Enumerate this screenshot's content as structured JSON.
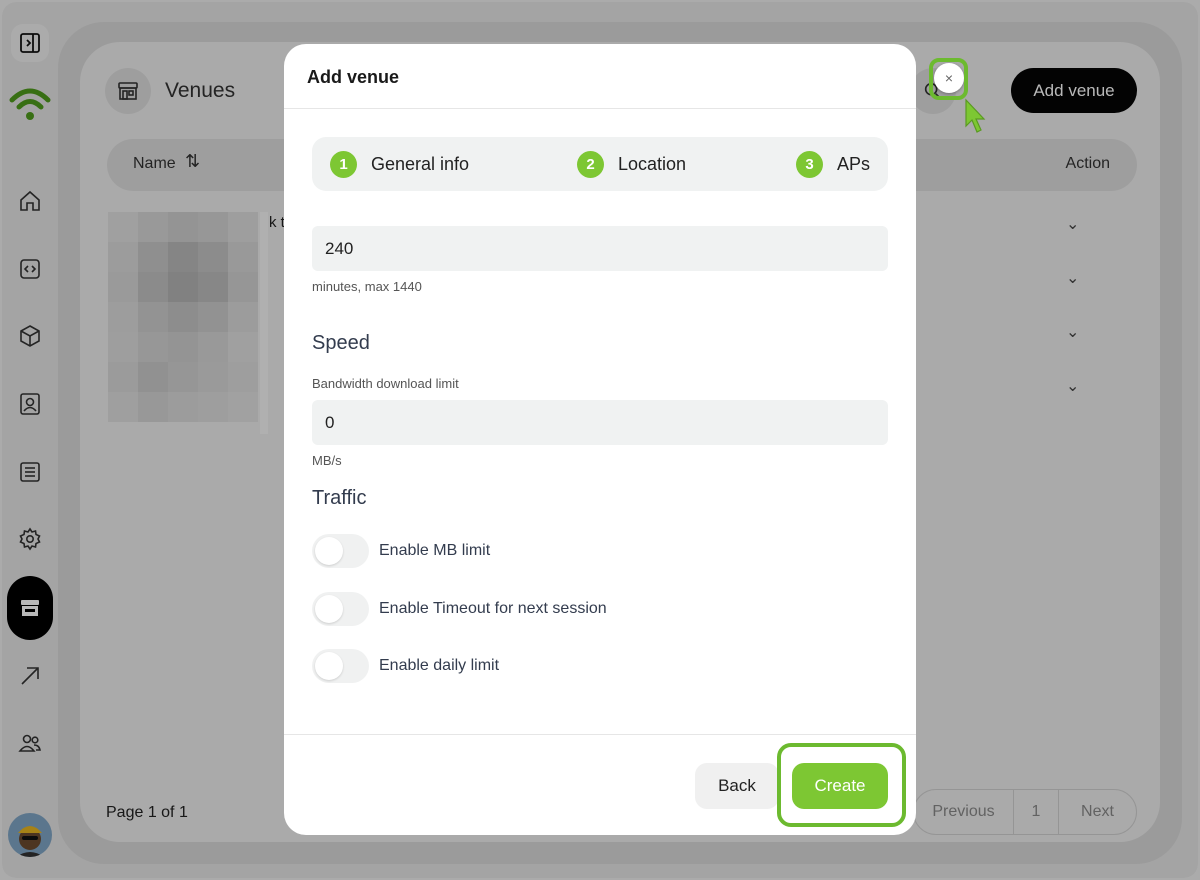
{
  "sidebar": {
    "items": [
      {
        "name": "home",
        "icon": "home-icon"
      },
      {
        "name": "code",
        "icon": "code-icon"
      },
      {
        "name": "box",
        "icon": "cube-icon"
      },
      {
        "name": "contacts",
        "icon": "contact-card-icon"
      },
      {
        "name": "reports",
        "icon": "list-icon"
      },
      {
        "name": "settings",
        "icon": "gear-icon"
      },
      {
        "name": "venues",
        "icon": "store-icon",
        "active": true
      },
      {
        "name": "analytics",
        "icon": "arrow-up-right-icon"
      },
      {
        "name": "users",
        "icon": "users-icon"
      }
    ]
  },
  "page": {
    "title": "Venues",
    "add_button": "Add venue",
    "table": {
      "columns": [
        "Name",
        "Action"
      ],
      "row_partial_text": "k t"
    },
    "pagination": {
      "info": "Page 1 of 1",
      "previous": "Previous",
      "current": "1",
      "next": "Next"
    }
  },
  "modal": {
    "title": "Add venue",
    "close_label": "×",
    "steps": [
      {
        "num": "1",
        "label": "General info"
      },
      {
        "num": "2",
        "label": "Location"
      },
      {
        "num": "3",
        "label": "APs"
      }
    ],
    "timeout": {
      "value": "240",
      "hint": "minutes, max 1440"
    },
    "speed": {
      "heading": "Speed",
      "label": "Bandwidth download limit",
      "value": "0",
      "unit": "MB/s"
    },
    "traffic": {
      "heading": "Traffic",
      "toggles": [
        {
          "label": "Enable MB limit",
          "on": false
        },
        {
          "label": "Enable Timeout for next session",
          "on": false
        },
        {
          "label": "Enable daily limit",
          "on": false
        }
      ]
    },
    "footer": {
      "back": "Back",
      "create": "Create"
    }
  },
  "colors": {
    "accent": "#7dc733",
    "highlight": "#6cba2f",
    "primary_button": "#050505"
  }
}
